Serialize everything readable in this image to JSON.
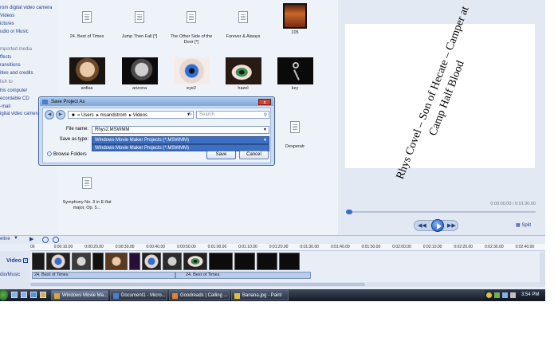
{
  "tasks": [
    {
      "label": "rom digital video camera",
      "header": false
    },
    {
      "label": "Videos",
      "header": false
    },
    {
      "label": "ictures",
      "header": false
    },
    {
      "label": "udio or Music",
      "header": false
    },
    {
      "label": "mported media",
      "header": true
    },
    {
      "label": "ffects",
      "header": false
    },
    {
      "label": "ransitions",
      "header": false
    },
    {
      "label": "itles and credits",
      "header": false
    },
    {
      "label": "lish to",
      "header": true
    },
    {
      "label": "his computer",
      "header": false
    },
    {
      "label": "ecordable CD",
      "header": false
    },
    {
      "label": "-mail",
      "header": false
    },
    {
      "label": "igital video camera",
      "header": false
    }
  ],
  "collection": {
    "row1": [
      "24. Best of Times",
      "Jump Then Fall [*]",
      "The Other Side of the Door [*]",
      "Forever & Always",
      "105"
    ],
    "row2": [
      "anfisa",
      "arizona",
      "eye2",
      "hazel",
      "key"
    ],
    "row3_label": "Desperatr",
    "row4_label": "Symphony No. 3 in E-flat major, Op. 5..."
  },
  "preview": {
    "text": "Rhys Covel – Son of Hecate – Camper at Camp Half Blood",
    "timecode": "0:00:00.00 / 0:01:30.00",
    "split_label": "Split",
    "position_fraction": 0.0
  },
  "timeline": {
    "toolbar_label": "eline",
    "video_label": "Video",
    "audio_label": "dio/Music",
    "ruler": [
      "00",
      "0:00:10.00",
      "0:00:20.00",
      "0:00:30.00",
      "0:00:40.00",
      "0:00:50.00",
      "0:01:00.00",
      "0:01:10.00",
      "0:01:20.00",
      "0:01:30.00",
      "0:01:40.00",
      "0:01:50.00",
      "0:02:00.00",
      "0:02:10.00",
      "0:02:20.00",
      "0:02:30.00",
      "0:02:40.00"
    ],
    "audio_clips": [
      "24. Best of Times",
      "24. Best of Times"
    ]
  },
  "dialog": {
    "title": "Save Project As",
    "close_label": "x",
    "breadcrumb": [
      "Users",
      "msandstrom",
      "Videos"
    ],
    "search_placeholder": "Search",
    "file_name_label": "File name:",
    "file_name_value": "Rhys2.MSWMM",
    "save_type_label": "Save as type:",
    "save_type_value": "Windows Movie Maker Projects (*.MSWMM)",
    "save_type_option": "Windows Movie Maker Projects (*.MSWMM)",
    "browse_label": "Browse Folders",
    "save_button": "Save",
    "cancel_button": "Cancel"
  },
  "taskbar": {
    "items": [
      "Windows Movie Ma...",
      "Document1 - Micro...",
      "Goodreads | Calling ...",
      "Banana.jpg - Paint"
    ],
    "clock": "3:54 PM"
  }
}
